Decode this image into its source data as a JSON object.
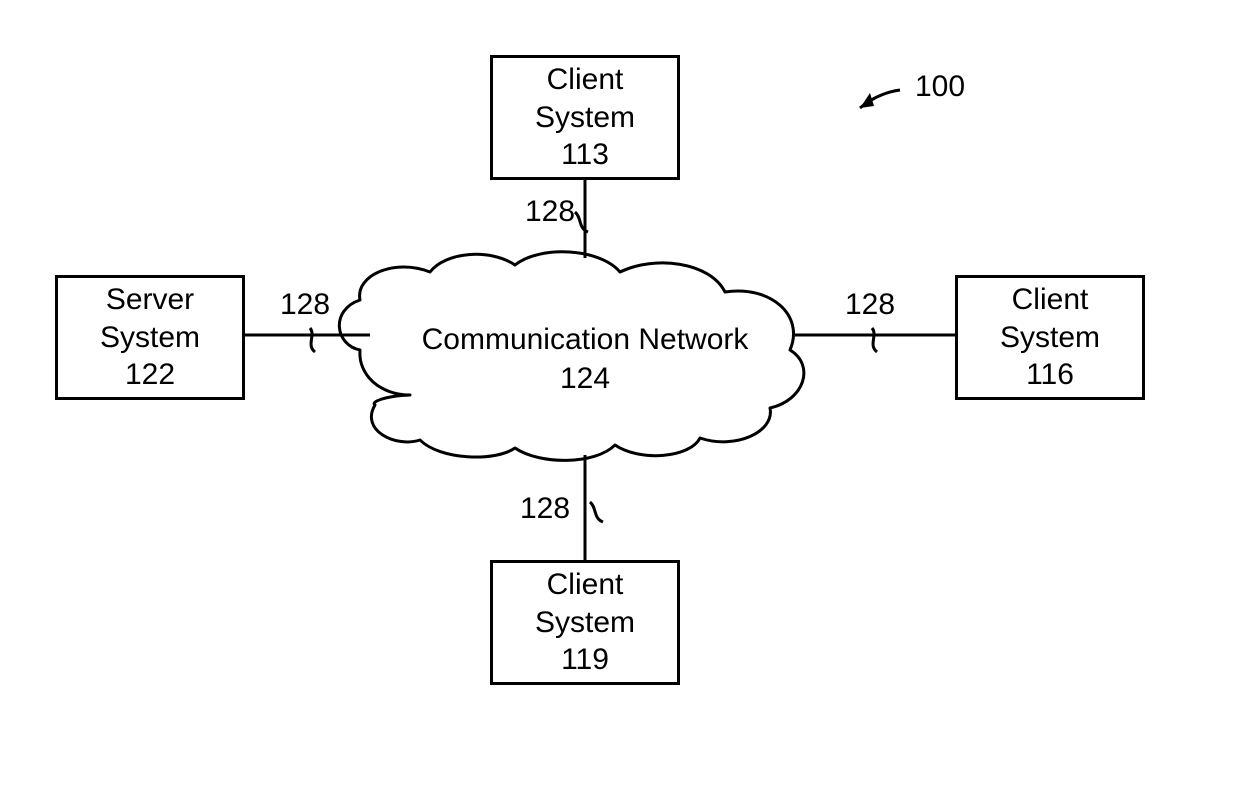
{
  "figure": {
    "ref_label": "100"
  },
  "network": {
    "label_line1": "Communication Network",
    "label_line2": "124"
  },
  "nodes": {
    "server": {
      "line1": "Server",
      "line2": "System",
      "line3": "122"
    },
    "client_top": {
      "line1": "Client",
      "line2": "System",
      "line3": "113"
    },
    "client_right": {
      "line1": "Client",
      "line2": "System",
      "line3": "116"
    },
    "client_bottom": {
      "line1": "Client",
      "line2": "System",
      "line3": "119"
    }
  },
  "links": {
    "top": {
      "label": "128"
    },
    "left": {
      "label": "128"
    },
    "right": {
      "label": "128"
    },
    "bottom": {
      "label": "128"
    }
  }
}
